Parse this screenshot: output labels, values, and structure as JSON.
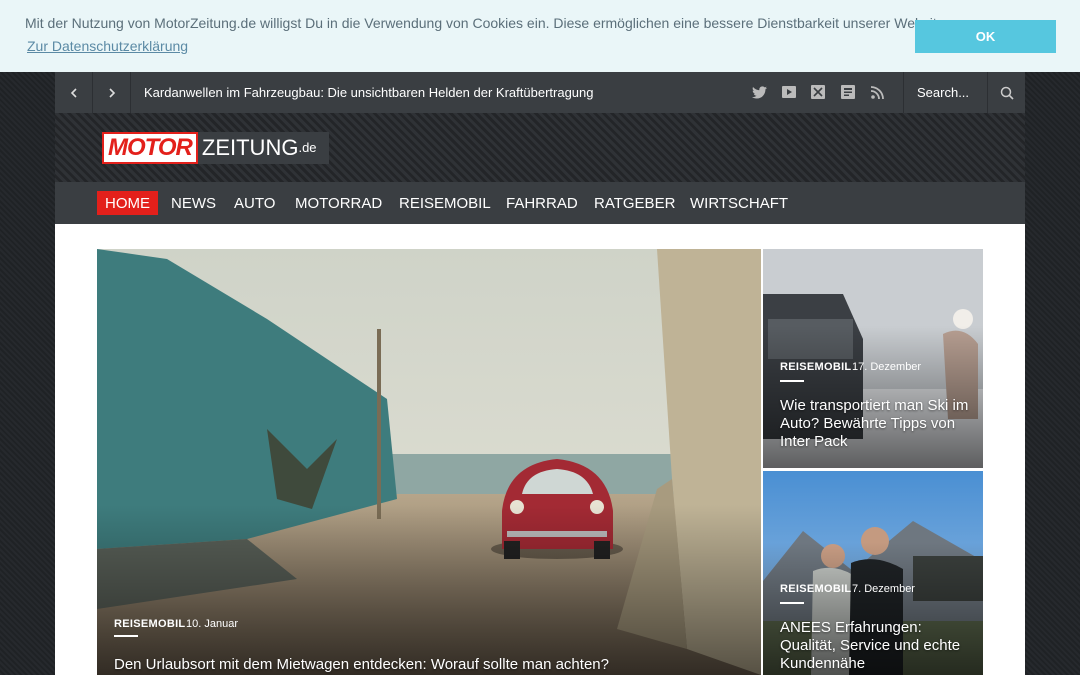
{
  "cookie": {
    "text": "Mit der Nutzung von MotorZeitung.de willigst Du in die Verwendung von Cookies ein. Diese ermöglichen eine bessere Dienstbarkeit unserer Website.",
    "link": "Zur Datenschutzerklärung",
    "ok": "OK"
  },
  "topbar": {
    "ticker": "Kardanwellen im Fahrzeugbau: Die unsichtbaren Helden der Kraftübertragung",
    "search_placeholder": "Search...",
    "social_icons": [
      "twitter-icon",
      "youtube-icon",
      "xing-icon",
      "flipboard-icon",
      "rss-icon"
    ]
  },
  "logo": {
    "motor": "MOTOR",
    "zeitung": "ZEITUNG",
    "de": ".de"
  },
  "menu": [
    "HOME",
    "NEWS",
    "AUTO",
    "MOTORRAD",
    "REISEMOBIL",
    "FAHRRAD",
    "RATGEBER",
    "WIRTSCHAFT"
  ],
  "articles": {
    "hero": {
      "category": "REISEMOBIL",
      "date": "10. Januar",
      "title": "Den Urlaubsort mit dem Mietwagen entdecken: Worauf sollte man achten?"
    },
    "side1": {
      "category": "REISEMOBIL",
      "date": "17. Dezember",
      "title": "Wie transportiert man Ski im Auto? Bewährte Tipps von Inter Pack"
    },
    "side2": {
      "category": "REISEMOBIL",
      "date": "7. Dezember",
      "title": "ANEES Erfahrungen: Qualität, Service und echte Kundennähe"
    }
  },
  "colors": {
    "accent": "#e3201b",
    "cookie_button": "#56c7df",
    "nav_bg": "#3a3e42"
  }
}
